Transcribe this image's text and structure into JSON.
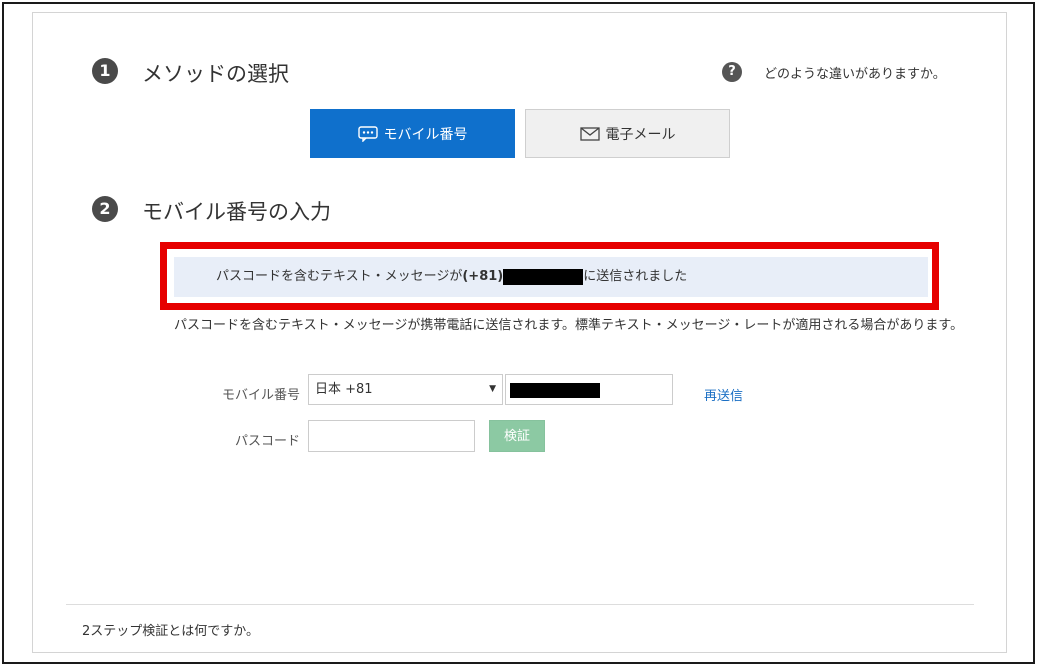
{
  "step1": {
    "number": "1",
    "title": "メソッドの選択"
  },
  "help": {
    "icon": "question-circle-icon",
    "text": "どのような違いがありますか。"
  },
  "methods": {
    "mobile": {
      "label": "モバイル番号",
      "icon": "chat-bubble-icon",
      "active": true
    },
    "email": {
      "label": "電子メール",
      "icon": "envelope-icon",
      "active": false
    }
  },
  "step2": {
    "number": "2",
    "title": "モバイル番号の入力"
  },
  "notice": {
    "prefix": "パスコードを含むテキスト・メッセージが",
    "country_code": "(+81)",
    "suffix": "に送信されました"
  },
  "description": "パスコードを含むテキスト・メッセージが携帯電話に送信されます。標準テキスト・メッセージ・レートが適用される場合があります。",
  "form": {
    "mobile_label": "モバイル番号",
    "country_selected": "日本 +81",
    "resend_label": "再送信",
    "passcode_label": "パスコード",
    "passcode_value": "",
    "verify_label": "検証"
  },
  "footer": {
    "link": "2ステップ検証とは何ですか。"
  },
  "colors": {
    "primary": "#0f70cc",
    "highlight": "#e60000",
    "verify": "#8cc9a3",
    "link": "#1a6fc4"
  }
}
